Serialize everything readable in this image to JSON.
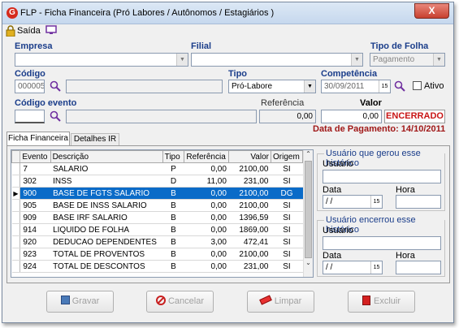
{
  "window": {
    "title": "FLP - Ficha Financeira (Pró Labores / Autônomos / Estagiários )",
    "close_label": "X"
  },
  "toolbar": {
    "saida_label": "Saída"
  },
  "labels": {
    "empresa": "Empresa",
    "filial": "Filial",
    "tipo_folha": "Tipo de Folha",
    "codigo": "Código",
    "tipo": "Tipo",
    "competencia": "Competência",
    "ativo": "Ativo",
    "codigo_evento": "Código evento",
    "referencia": "Referência",
    "valor": "Valor"
  },
  "fields": {
    "empresa": "",
    "filial": "",
    "tipo_folha": "Pagamento",
    "codigo": "000005",
    "codigo_nome": "",
    "tipo": "Pró-Labore",
    "competencia": "30/09/2011",
    "codigo_evento": "",
    "evento_desc": "",
    "referencia": "0,00",
    "valor": "0,00"
  },
  "status": {
    "encerrado": "ENCERRADO",
    "data_pagamento": "Data de Pagamento: 14/10/2011"
  },
  "tabs": [
    {
      "label": "Ficha Financeira"
    },
    {
      "label": "Detalhes IR"
    }
  ],
  "table": {
    "columns": [
      "Evento",
      "Descrição",
      "Tipo",
      "Referência",
      "Valor",
      "Origem"
    ],
    "rows": [
      [
        "7",
        "SALARIO",
        "P",
        "0,00",
        "2100,00",
        "SI"
      ],
      [
        "302",
        "INSS",
        "D",
        "11,00",
        "231,00",
        "SI"
      ],
      [
        "900",
        "BASE DE FGTS SALARIO",
        "B",
        "0,00",
        "2100,00",
        "DG"
      ],
      [
        "905",
        "BASE DE INSS SALARIO",
        "B",
        "0,00",
        "2100,00",
        "SI"
      ],
      [
        "909",
        "BASE IRF SALARIO",
        "B",
        "0,00",
        "1396,59",
        "SI"
      ],
      [
        "914",
        "LIQUIDO DE FOLHA",
        "B",
        "0,00",
        "1869,00",
        "SI"
      ],
      [
        "920",
        "DEDUCAO DEPENDENTES",
        "B",
        "3,00",
        "472,41",
        "SI"
      ],
      [
        "923",
        "TOTAL DE PROVENTOS",
        "B",
        "0,00",
        "2100,00",
        "SI"
      ],
      [
        "924",
        "TOTAL DE DESCONTOS",
        "B",
        "0,00",
        "231,00",
        "SI"
      ]
    ],
    "selected_row": 2
  },
  "history1": {
    "title": "Usuário que gerou esse histórico",
    "usuario_label": "Usuario",
    "data_label": "Data",
    "hora_label": "Hora",
    "data_value": "/ /"
  },
  "history2": {
    "title": "Usuário encerrou esse histórico",
    "usuario_label": "Usuario",
    "data_label": "Data",
    "hora_label": "Hora",
    "data_value": "/ /"
  },
  "buttons": {
    "gravar": "Gravar",
    "cancelar": "Cancelar",
    "limpar": "Limpar",
    "excluir": "Excluir"
  },
  "colors": {
    "accent": "#1a3d8a",
    "selection": "#0a6bc8",
    "encerrado": "#c81414"
  }
}
